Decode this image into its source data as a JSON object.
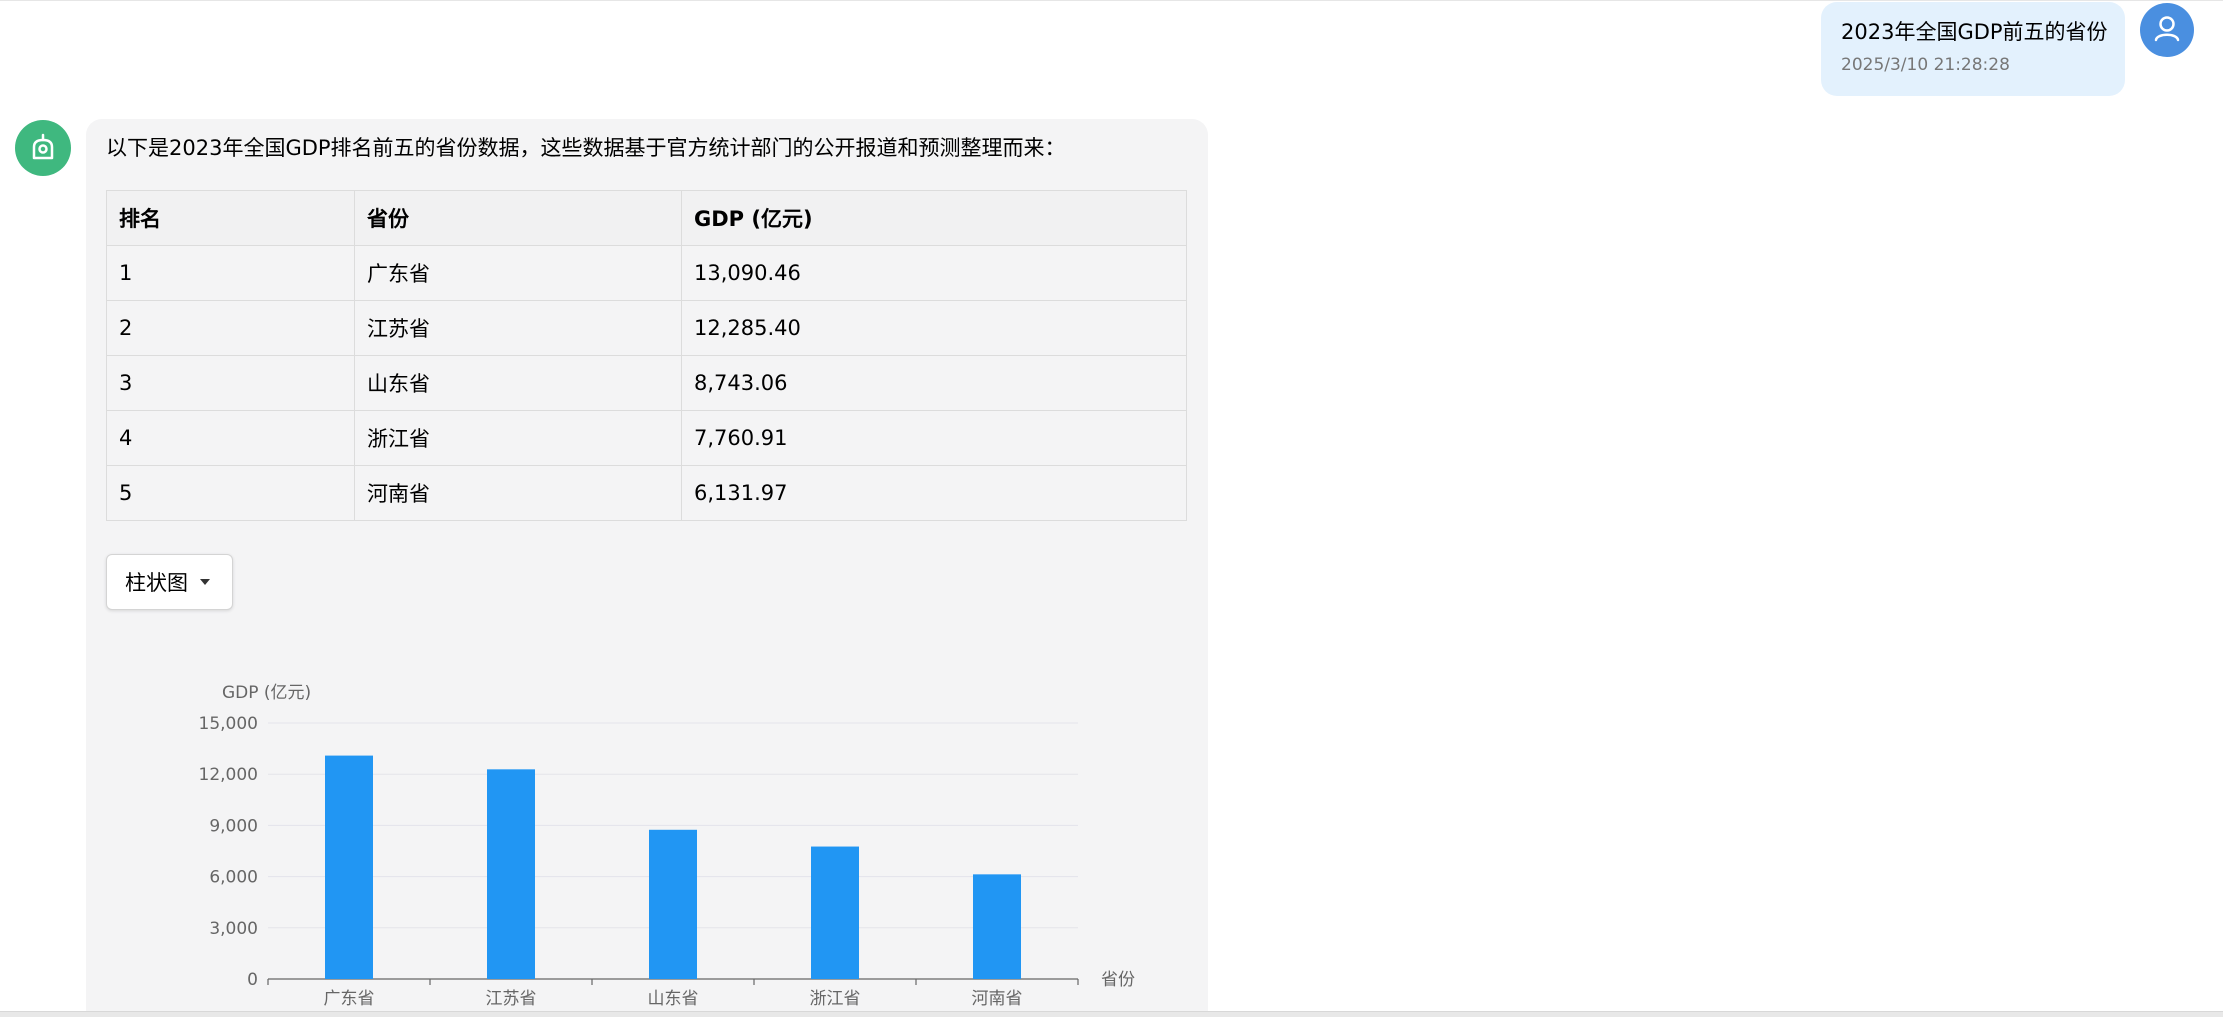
{
  "user_message": {
    "text": "2023年全国GDP前五的省份",
    "timestamp": "2025/3/10 21:28:28"
  },
  "assistant_message": {
    "intro": "以下是2023年全国GDP排名前五的省份数据，这些数据基于官方统计部门的公开报道和预测整理而来：",
    "table": {
      "headers": [
        "排名",
        "省份",
        "GDP (亿元)"
      ],
      "rows": [
        [
          "1",
          "广东省",
          "13,090.46"
        ],
        [
          "2",
          "江苏省",
          "12,285.40"
        ],
        [
          "3",
          "山东省",
          "8,743.06"
        ],
        [
          "4",
          "浙江省",
          "7,760.91"
        ],
        [
          "5",
          "河南省",
          "6,131.97"
        ]
      ]
    },
    "chart_type_select": {
      "value": "柱状图"
    }
  },
  "colors": {
    "bar": "#2196f3",
    "user_bubble": "#e3f1fd",
    "user_avatar": "#4a8fe0",
    "ai_avatar": "#3fb87f",
    "ai_bubble": "#f4f4f5"
  },
  "icons": {
    "user_avatar": "user-icon",
    "ai_avatar": "robot-icon",
    "select_caret": "caret-down-icon"
  },
  "chart_data": {
    "type": "bar",
    "categories": [
      "广东省",
      "江苏省",
      "山东省",
      "浙江省",
      "河南省"
    ],
    "values": [
      13090.46,
      12285.4,
      8743.06,
      7760.91,
      6131.97
    ],
    "ylabel": "GDP (亿元)",
    "xlabel": "省份",
    "ylim": [
      0,
      15000
    ],
    "yticks": [
      "0",
      "3,000",
      "6,000",
      "9,000",
      "12,000",
      "15,000"
    ],
    "grid": true
  }
}
